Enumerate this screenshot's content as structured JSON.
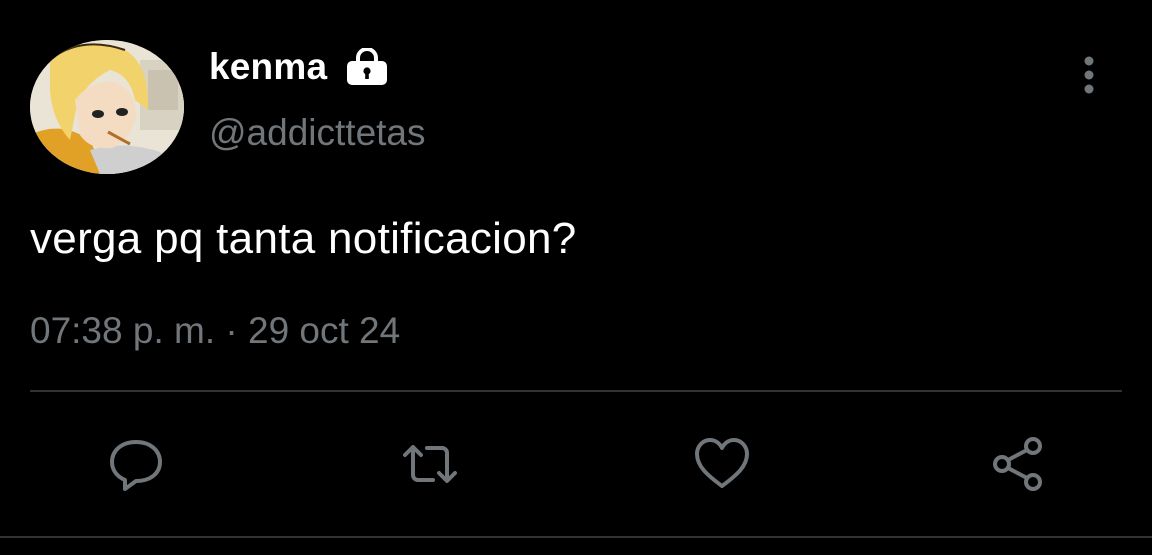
{
  "tweet": {
    "display_name": "kenma",
    "handle": "@addicttetas",
    "text": "verga pq tanta notificacion?",
    "timestamp": "07:38 p. m. · 29 oct 24",
    "protected": true
  },
  "icons": {
    "lock": "lock-icon",
    "more": "more-vertical-icon",
    "reply": "reply-icon",
    "retweet": "retweet-icon",
    "like": "heart-icon",
    "share": "share-icon"
  },
  "colors": {
    "background": "#000000",
    "primary_text": "#ffffff",
    "secondary_text": "#71767b",
    "divider": "#2f3336",
    "icon": "#71767b"
  }
}
